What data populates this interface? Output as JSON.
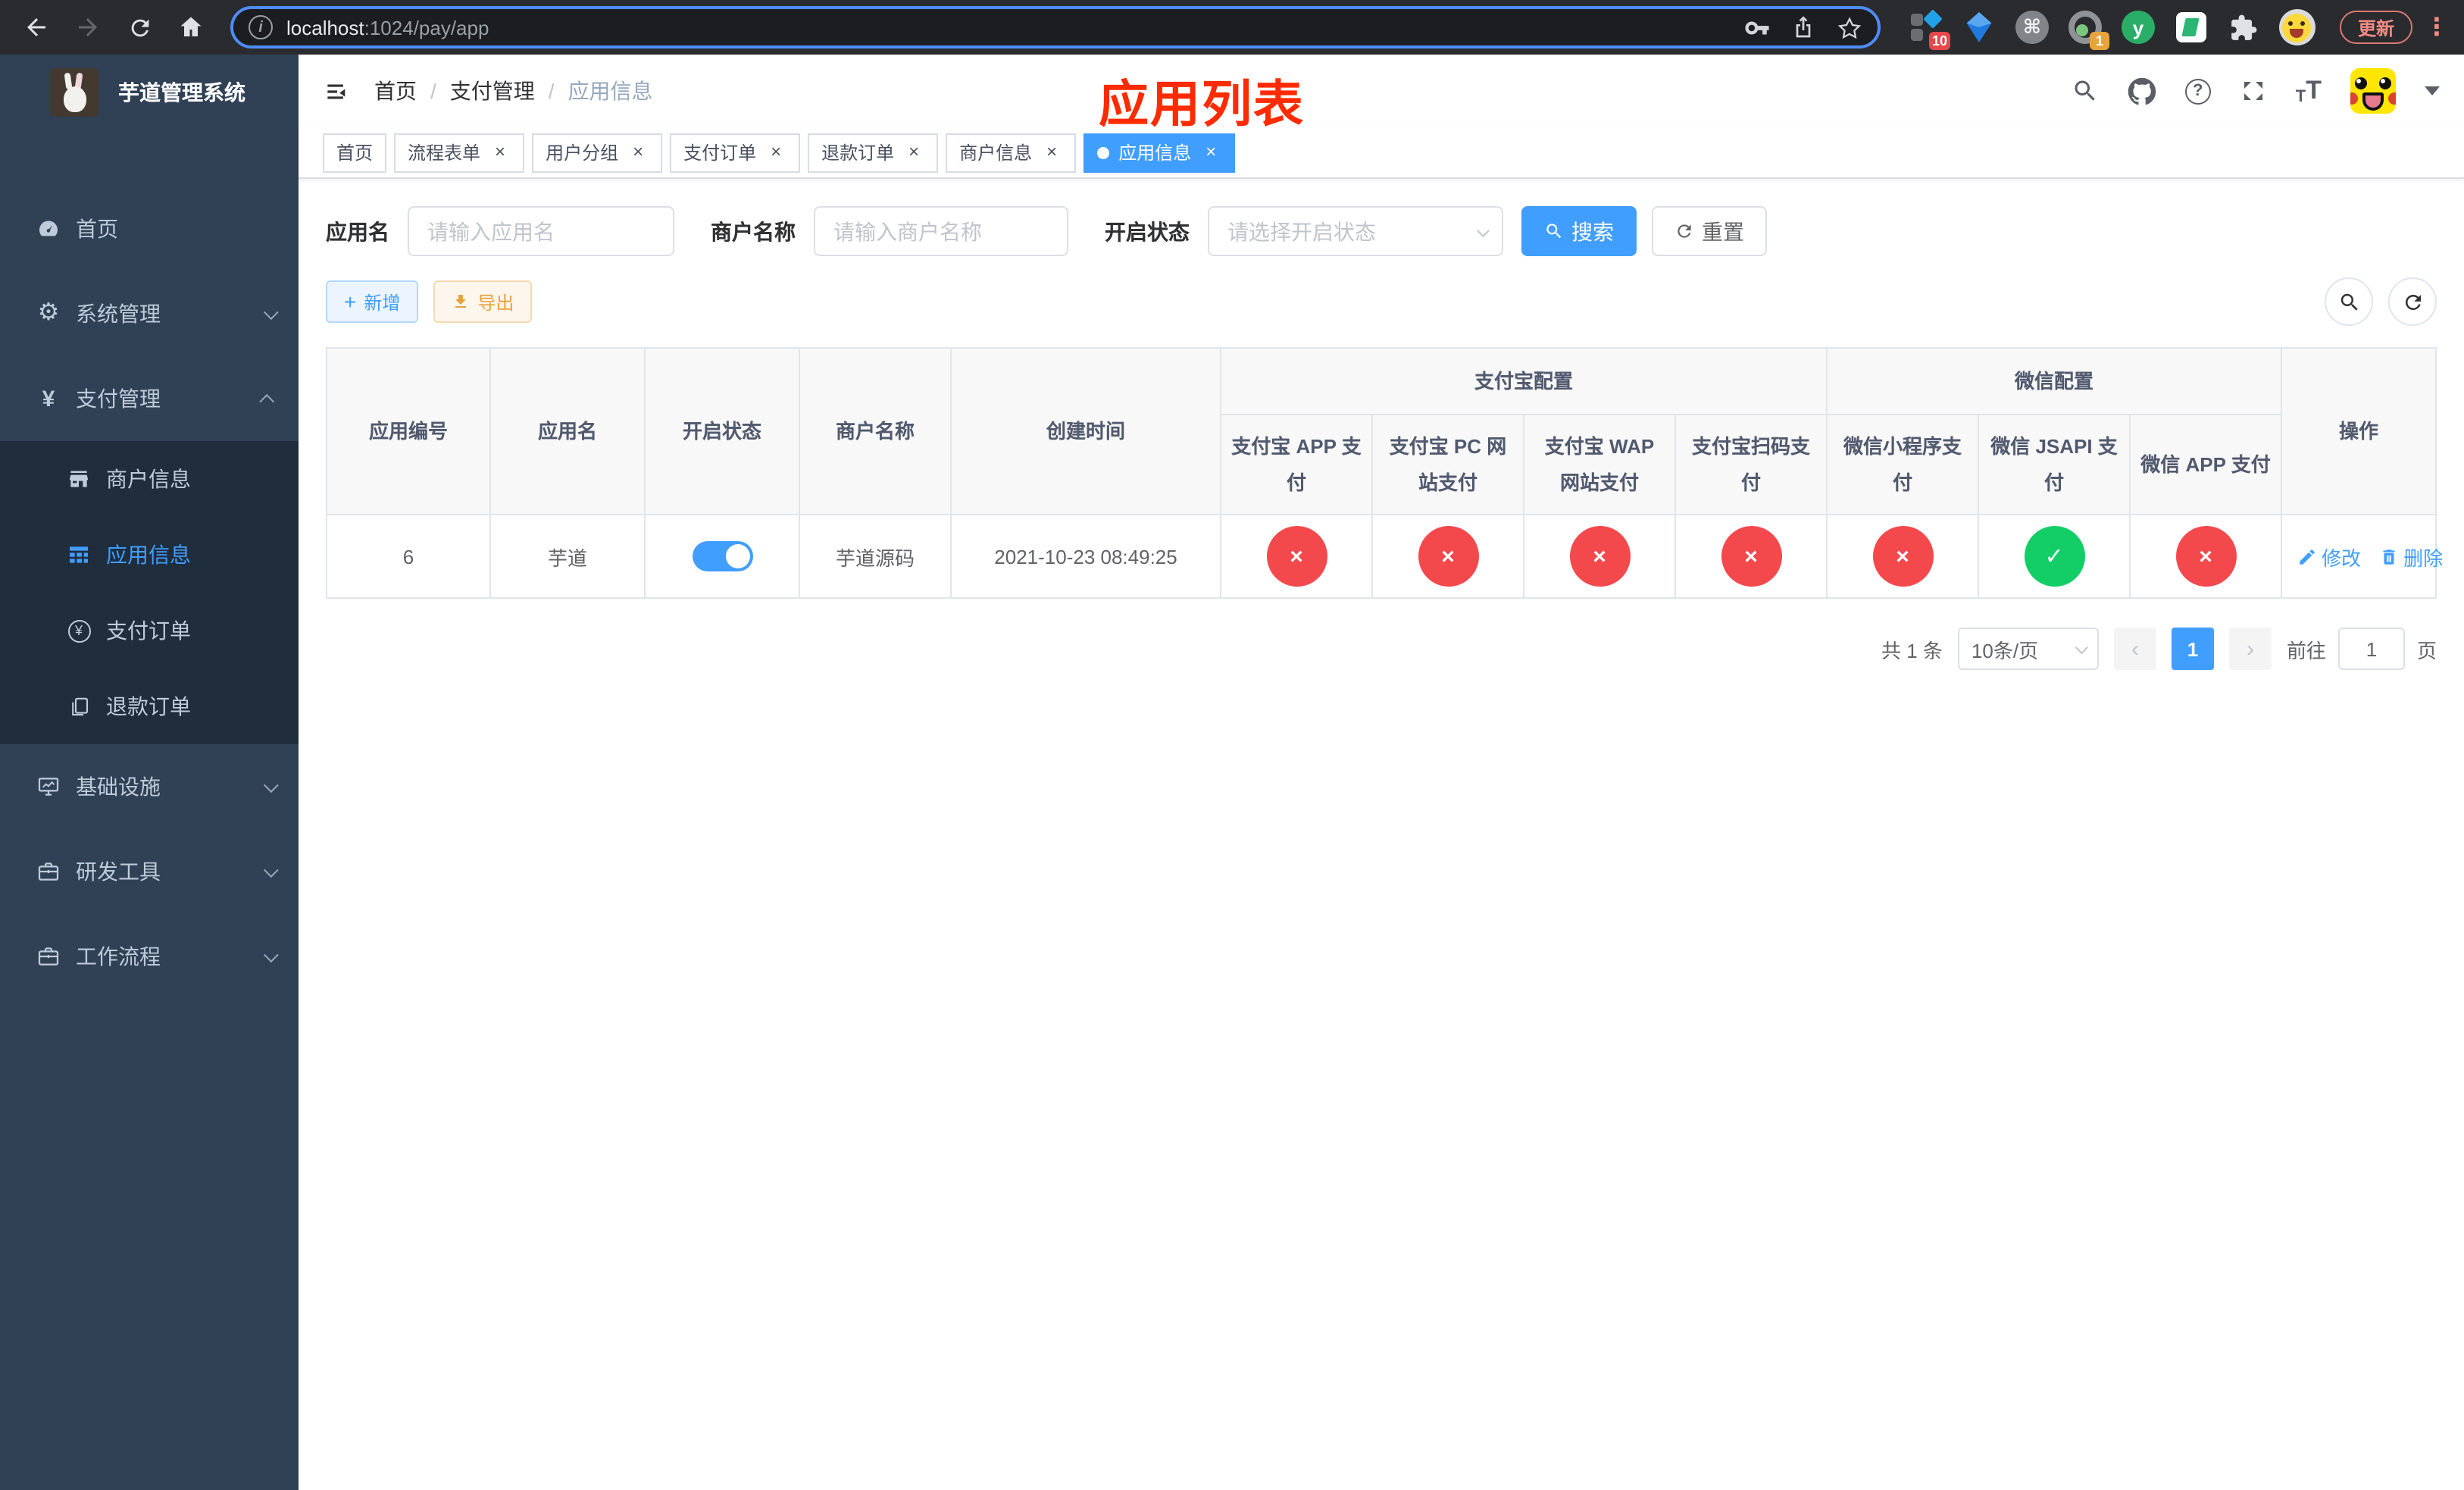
{
  "glyphs": {
    "close": "×",
    "check": "✓",
    "cross": "×",
    "plus": "+",
    "sep": "/",
    "prev": "‹",
    "next": "›",
    "command": "⌘",
    "kebab": "⋮",
    "question": "?",
    "info": "i",
    "yen": "¥",
    "gear": "⚙",
    "t": "T",
    "y": "y"
  },
  "browser": {
    "url_host": "localhost",
    "url_rest": ":1024/pay/app",
    "update_label": "更新",
    "ext_badge_scripts": "10",
    "ext_badge_record": "1",
    "ext_yuque_letter": "y"
  },
  "sidebar": {
    "title": "芋道管理系统",
    "items": [
      {
        "label": "首页"
      },
      {
        "label": "系统管理"
      },
      {
        "label": "支付管理"
      },
      {
        "label": "商户信息"
      },
      {
        "label": "应用信息"
      },
      {
        "label": "支付订单"
      },
      {
        "label": "退款订单"
      },
      {
        "label": "基础设施"
      },
      {
        "label": "研发工具"
      },
      {
        "label": "工作流程"
      }
    ]
  },
  "header": {
    "breadcrumb": [
      "首页",
      "支付管理",
      "应用信息"
    ],
    "overlay_title": "应用列表"
  },
  "tabs": [
    {
      "label": "首页",
      "closable": false,
      "active": false
    },
    {
      "label": "流程表单",
      "closable": true,
      "active": false
    },
    {
      "label": "用户分组",
      "closable": true,
      "active": false
    },
    {
      "label": "支付订单",
      "closable": true,
      "active": false
    },
    {
      "label": "退款订单",
      "closable": true,
      "active": false
    },
    {
      "label": "商户信息",
      "closable": true,
      "active": false
    },
    {
      "label": "应用信息",
      "closable": true,
      "active": true
    }
  ],
  "filters": {
    "app_name_label": "应用名",
    "app_name_placeholder": "请输入应用名",
    "merchant_label": "商户名称",
    "merchant_placeholder": "请输入商户名称",
    "status_label": "开启状态",
    "status_placeholder": "请选择开启状态",
    "search_label": "搜索",
    "reset_label": "重置"
  },
  "toolbar": {
    "add_label": "新增",
    "export_label": "导出"
  },
  "table": {
    "simple_columns": [
      "应用编号",
      "应用名",
      "开启状态",
      "商户名称",
      "创建时间"
    ],
    "alipay_group": "支付宝配置",
    "wechat_group": "微信配置",
    "action_column": "操作",
    "alipay_columns": [
      "支付宝 APP 支付",
      "支付宝 PC 网站支付",
      "支付宝 WAP 网站支付",
      "支付宝扫码支付"
    ],
    "wechat_columns": [
      "微信小程序支付",
      "微信 JSAPI 支付",
      "微信 APP 支付"
    ],
    "row": {
      "id": "6",
      "name": "芋道",
      "enabled": true,
      "merchant": "芋道源码",
      "created_at": "2021-10-23 08:49:25",
      "pay_statuses": [
        false,
        false,
        false,
        false,
        false,
        true,
        false
      ],
      "edit_label": "修改",
      "delete_label": "删除"
    }
  },
  "pagination": {
    "total": "共 1 条",
    "page_size": "10条/页",
    "current_page": "1",
    "goto_label": "前往",
    "goto_value": "1",
    "goto_suffix": "页"
  }
}
